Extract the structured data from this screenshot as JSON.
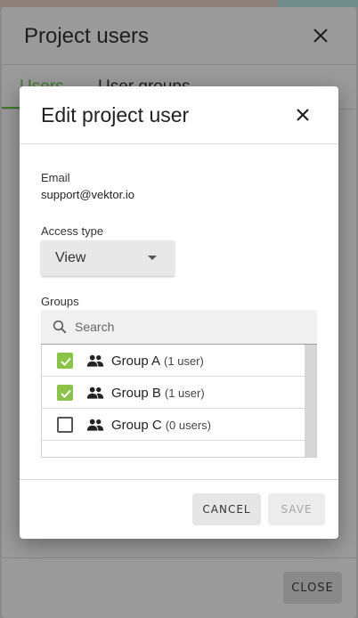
{
  "outer_dialog": {
    "title": "Project users",
    "tabs": [
      {
        "label": "Users",
        "active": true
      },
      {
        "label": "User groups",
        "active": false
      }
    ],
    "close_button_label": "CLOSE"
  },
  "modal": {
    "title": "Edit project user",
    "email_label": "Email",
    "email_value": "support@vektor.io",
    "access_type_label": "Access type",
    "access_type_value": "View",
    "groups_label": "Groups",
    "search_placeholder": "Search",
    "groups": [
      {
        "name": "Group A",
        "count": "(1 user)",
        "checked": true
      },
      {
        "name": "Group B",
        "count": "(1 user)",
        "checked": true
      },
      {
        "name": "Group C",
        "count": "(0 users)",
        "checked": false
      }
    ],
    "cancel_label": "CANCEL",
    "save_label": "SAVE"
  },
  "colors": {
    "accent_green": "#8bc34a",
    "tab_active_green": "#3f7a2b",
    "overlay": "#9b9b9b"
  }
}
